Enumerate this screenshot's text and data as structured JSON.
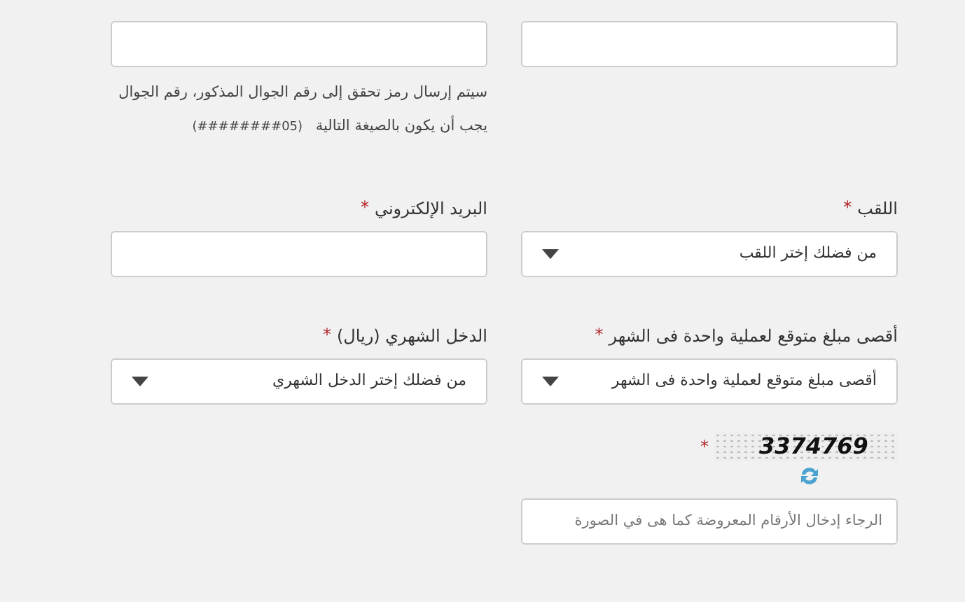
{
  "rows": [
    {
      "fields": [
        {
          "kind": "input"
        },
        {
          "kind": "input",
          "hint": {
            "text": "سيتم إرسال رمز تحقق إلى رقم الجوال المذكور، رقم الجوال يجب أن يكون بالصيغة التالية",
            "format": "(05########)"
          }
        }
      ]
    },
    {
      "fields": [
        {
          "kind": "select",
          "label": "اللقب",
          "required_mark": "*",
          "placeholder": "من فضلك إختر اللقب"
        },
        {
          "kind": "input",
          "label": "البريد الإلكتروني",
          "required_mark": "*"
        }
      ]
    },
    {
      "fields": [
        {
          "kind": "select",
          "label": "أقصى مبلغ متوقع لعملية واحدة فى الشهر",
          "required_mark": "*",
          "placeholder": "أقصى مبلغ متوقع لعملية واحدة فى الشهر"
        },
        {
          "kind": "select",
          "label": "الدخل الشهري (ريال)",
          "required_mark": "*",
          "placeholder": "من فضلك إختر الدخل الشهري"
        }
      ]
    }
  ],
  "captcha": {
    "code": "3374769",
    "required_mark": "*",
    "placeholder": "الرجاء إدخال الأرقام المعروضة كما هى في الصورة"
  }
}
